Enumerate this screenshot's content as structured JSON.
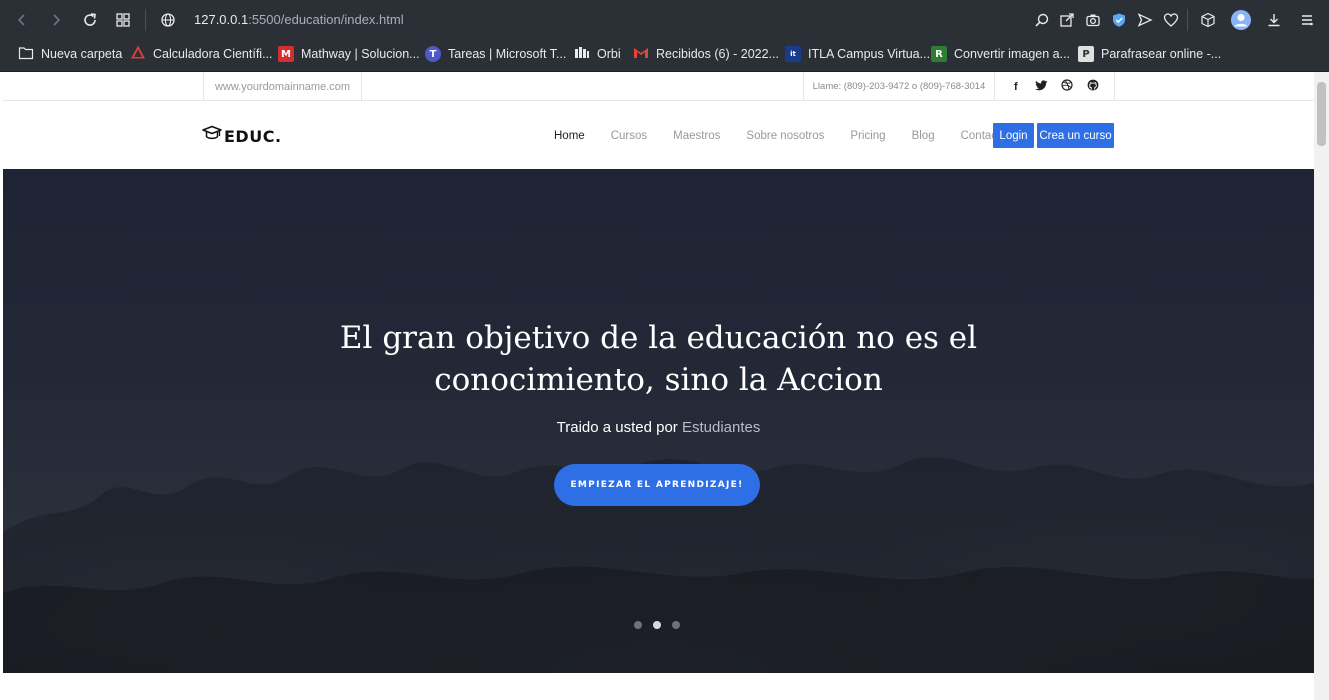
{
  "browser": {
    "url_host": "127.0.0.1",
    "url_rest": ":5500/education/index.html",
    "bookmarks": [
      {
        "label": "Nueva carpeta",
        "icon": "folder-icon"
      },
      {
        "label": "Calculadora Científi...",
        "icon": "calculator-favicon"
      },
      {
        "label": "Mathway | Solucion...",
        "icon": "mathway-favicon"
      },
      {
        "label": "Tareas | Microsoft T...",
        "icon": "teams-favicon"
      },
      {
        "label": "Orbi",
        "icon": "orbi-favicon"
      },
      {
        "label": "Recibidos (6) - 2022...",
        "icon": "gmail-favicon"
      },
      {
        "label": "ITLA Campus Virtua...",
        "icon": "itla-favicon"
      },
      {
        "label": "Convertir imagen a...",
        "icon": "convert-favicon"
      },
      {
        "label": "Parafrasear online -...",
        "icon": "paraphrase-favicon"
      }
    ]
  },
  "topbar": {
    "domain": "www.yourdomainname.com",
    "phone": "Llame: (809)-203-9472 o (809)-768-3014",
    "socials": [
      "f",
      "t",
      "d",
      "g"
    ]
  },
  "navbar": {
    "logo": "EDUC.",
    "links": [
      "Home",
      "Cursos",
      "Maestros",
      "Sobre nosotros",
      "Pricing",
      "Blog",
      "Contactos"
    ],
    "login": "Login",
    "create": "Crea un curso"
  },
  "hero": {
    "title_line1": "El gran objetivo de la educación no es el",
    "title_line2": "conocimiento, sino la Accion",
    "byline_prefix": "Traido a usted por",
    "byline_highlight": "Estudiantes",
    "cta": "EMPIEZAR EL APRENDIZAJE!",
    "slides": 3,
    "active_slide": 2
  },
  "colors": {
    "accent": "#2e6fe6",
    "chrome": "#2b2f36"
  }
}
